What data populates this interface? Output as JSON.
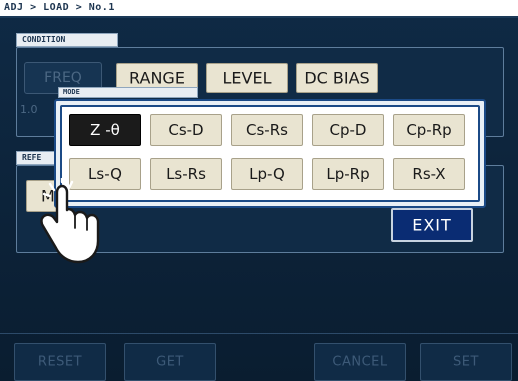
{
  "breadcrumb": "ADJ > LOAD > No.1",
  "condition": {
    "tab_label": "CONDITION",
    "buttons": [
      "FREQ",
      "RANGE",
      "LEVEL",
      "DC BIAS"
    ],
    "freq_value": "1.0"
  },
  "reference": {
    "tab_label": "REFE",
    "mode_button_label": "M"
  },
  "mode_dialog": {
    "tab_label": "MODE",
    "selected": "Z -θ",
    "options_row1": [
      "Z -θ",
      "Cs-D",
      "Cs-Rs",
      "Cp-D",
      "Cp-Rp"
    ],
    "options_row2": [
      "Ls-Q",
      "Ls-Rs",
      "Lp-Q",
      "Lp-Rp",
      "Rs-X"
    ]
  },
  "exit_label": "EXIT",
  "bottom_bar": {
    "reset": "RESET",
    "get": "GET",
    "cancel": "CANCEL",
    "set": "SET"
  },
  "colors": {
    "screen_bg": "#0e2338",
    "button_face": "#e9e4d1",
    "selected_face": "#1b1b1b",
    "exit_face": "#0a2c73",
    "dialog_border": "#1b4a86"
  },
  "icons": {
    "pointer": "tap-hand-icon"
  }
}
